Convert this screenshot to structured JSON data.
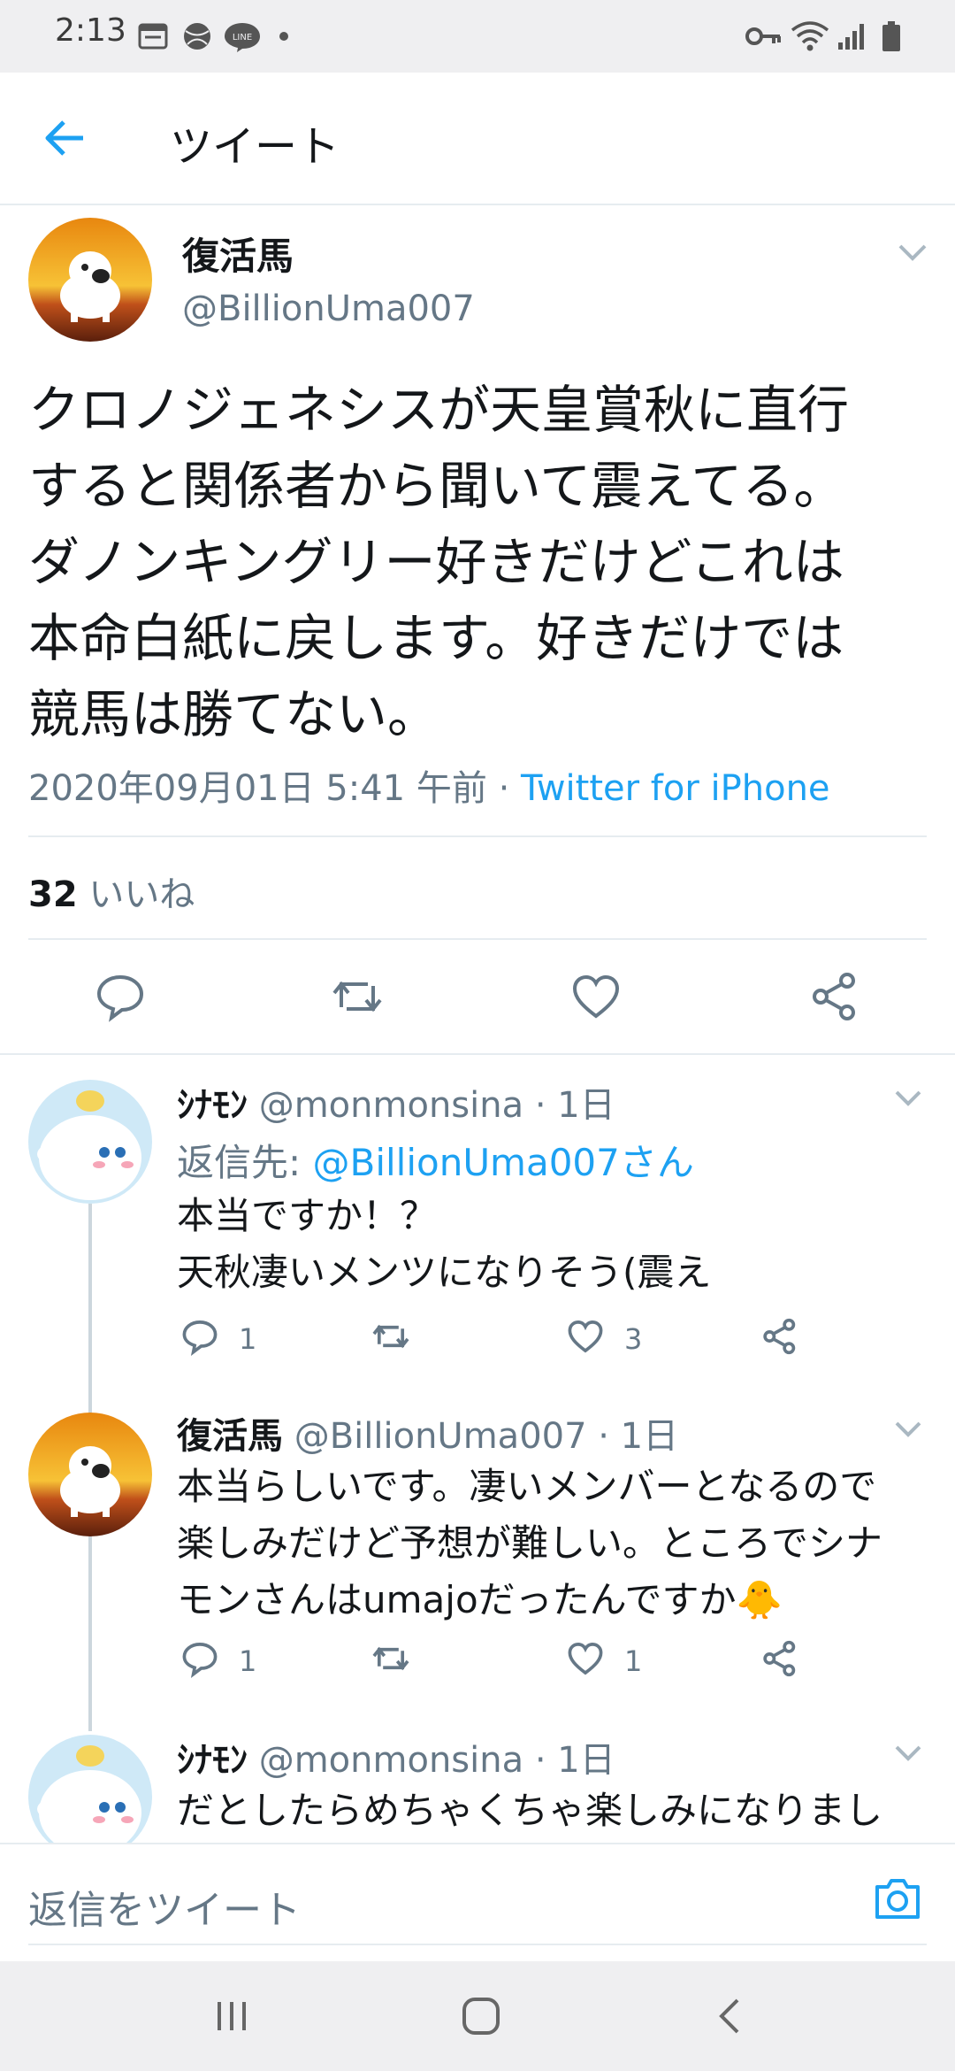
{
  "status_bar": {
    "time": "2:13"
  },
  "header": {
    "title": "ツイート"
  },
  "main_tweet": {
    "name": "復活馬",
    "handle": "@BillionUma007",
    "text": "クロノジェネシスが天皇賞秋に直行\nすると関係者から聞いて震えてる。\nダノンキングリー好きだけどこれは\n本命白紙に戻します。好きだけでは\n競馬は勝てない。",
    "datetime": "2020年09月01日 5:41 午前",
    "separator": " · ",
    "source": "Twitter for iPhone",
    "likes_count": "32",
    "likes_label": " いいね"
  },
  "replies": [
    {
      "name": "ｼﾅﾓﾝ",
      "handle": " @monmonsina · 1日",
      "reply_to_label": "返信先: ",
      "reply_to_handle": "@BillionUma007さん",
      "text": "本当ですか！？\n天秋凄いメンツになりそう(震え",
      "reply_count": "1",
      "retweet_count": "",
      "like_count": "3"
    },
    {
      "name": "復活馬",
      "handle": " @BillionUma007 · 1日",
      "text": "本当らしいです。凄いメンバーとなるので\n楽しみだけど予想が難しい。ところでシナ\nモンさんはumajoだったんですか🐥",
      "reply_count": "1",
      "retweet_count": "",
      "like_count": "1"
    },
    {
      "name": "ｼﾅﾓﾝ",
      "handle": " @monmonsina · 1日",
      "text": "だとしたらめちゃくちゃ楽しみになりまし"
    }
  ],
  "compose": {
    "placeholder": "返信をツイート"
  },
  "colors": {
    "accent": "#1da1f2",
    "secondary_text": "#657786",
    "divider": "#e6ecf0"
  }
}
